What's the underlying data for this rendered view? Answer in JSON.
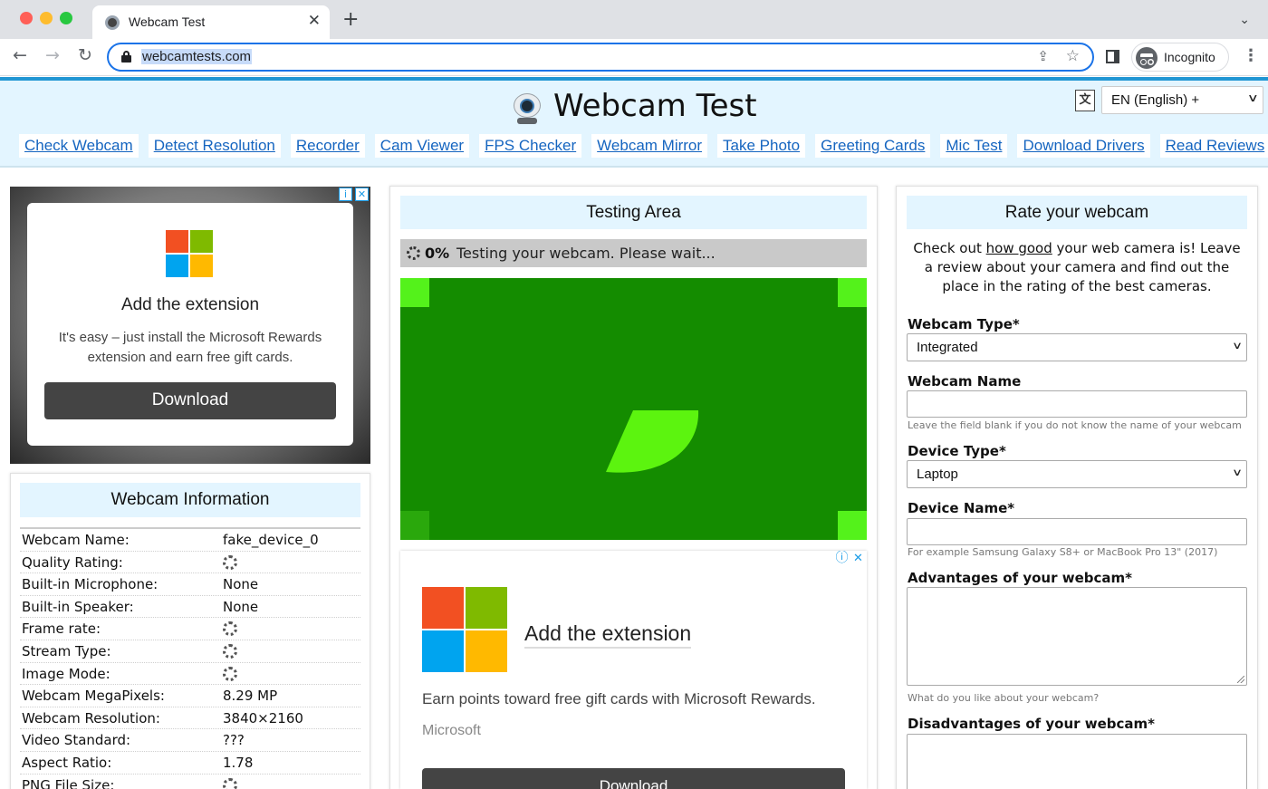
{
  "browser": {
    "tab_title": "Webcam Test",
    "tab_close": "✕",
    "new_tab": "+",
    "url": "webcamtests.com",
    "profile_label": "Incognito"
  },
  "site": {
    "title": "Webcam Test",
    "language": "EN (English) +",
    "language_icon": "translate-icon",
    "nav": [
      "Check Webcam",
      "Detect Resolution",
      "Recorder",
      "Cam Viewer",
      "FPS Checker",
      "Webcam Mirror",
      "Take Photo",
      "Greeting Cards",
      "Mic Test",
      "Download Drivers",
      "Read Reviews"
    ]
  },
  "ad_left": {
    "title": "Add the extension",
    "text": "It's easy – just install the Microsoft Rewards extension and earn free gift cards.",
    "button": "Download"
  },
  "webcam_info": {
    "heading": "Webcam Information",
    "rows": [
      {
        "label": "Webcam Name:",
        "value": "fake_device_0",
        "loading": false
      },
      {
        "label": "Quality Rating:",
        "value": "",
        "loading": true
      },
      {
        "label": "Built-in Microphone:",
        "value": "None",
        "loading": false
      },
      {
        "label": "Built-in Speaker:",
        "value": "None",
        "loading": false
      },
      {
        "label": "Frame rate:",
        "value": "",
        "loading": true
      },
      {
        "label": "Stream Type:",
        "value": "",
        "loading": true
      },
      {
        "label": "Image Mode:",
        "value": "",
        "loading": true
      },
      {
        "label": "Webcam MegaPixels:",
        "value": "8.29 MP",
        "loading": false
      },
      {
        "label": "Webcam Resolution:",
        "value": "3840×2160",
        "loading": false
      },
      {
        "label": "Video Standard:",
        "value": "???",
        "loading": false
      },
      {
        "label": "Aspect Ratio:",
        "value": "1.78",
        "loading": false
      },
      {
        "label": "PNG File Size:",
        "value": "",
        "loading": true
      }
    ]
  },
  "testing": {
    "heading": "Testing Area",
    "progress_percent": "0%",
    "progress_message": "Testing your webcam. Please wait...",
    "video_colors": {
      "background": "#148c00",
      "foreground": "#54f21b"
    }
  },
  "ad_center": {
    "title": "Add the extension",
    "text": "Earn points toward free gift cards with Microsoft Rewards.",
    "brand": "Microsoft",
    "button": "Download"
  },
  "rate": {
    "heading": "Rate your webcam",
    "intro_before": "Check out ",
    "intro_link": "how good",
    "intro_after": " your web camera is! Leave a review about your camera and find out the place in the rating of the best cameras.",
    "webcam_type_label": "Webcam Type*",
    "webcam_type_value": "Integrated",
    "webcam_name_label": "Webcam Name",
    "webcam_name_hint": "Leave the field blank if you do not know the name of your webcam",
    "device_type_label": "Device Type*",
    "device_type_value": "Laptop",
    "device_name_label": "Device Name*",
    "device_name_hint": "For example Samsung Galaxy S8+ or MacBook Pro 13\" (2017)",
    "advantages_label": "Advantages of your webcam*",
    "advantages_hint": "What do you like about your webcam?",
    "disadvantages_label": "Disadvantages of your webcam*"
  },
  "colors": {
    "accent": "#2196d3",
    "header_bg": "#e3f5ff",
    "link": "#1565c0",
    "ms_red": "#f25022",
    "ms_green": "#7fba00",
    "ms_blue": "#00a4ef",
    "ms_yellow": "#ffb900"
  }
}
